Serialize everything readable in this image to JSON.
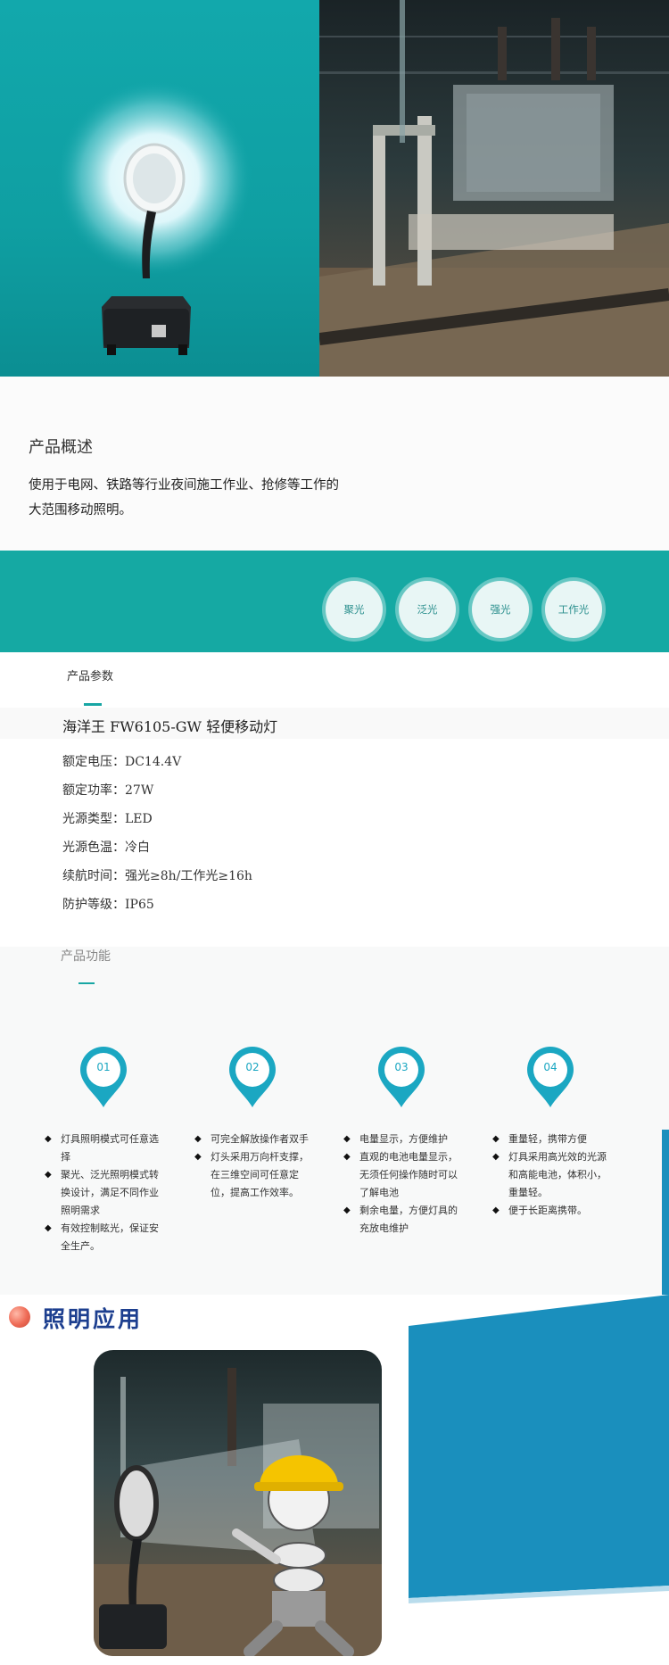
{
  "overview": {
    "title": "产品概述",
    "text_line1": "使用于电网、铁路等行业夜间施工作业、抢修等工作的",
    "text_line2": "大范围移动照明。"
  },
  "modes": [
    "聚光",
    "泛光",
    "强光",
    "工作光"
  ],
  "params": {
    "label": "产品参数",
    "title": "海洋王 FW6105-GW 轻便移动灯",
    "specs": [
      "额定电压：DC14.4V",
      "额定功率：27W",
      "光源类型：LED",
      "光源色温：冷白",
      "续航时间：强光≥8h/工作光≥16h",
      "防护等级：IP65"
    ]
  },
  "features": {
    "label": "产品功能",
    "numbers": [
      "01",
      "02",
      "03",
      "04"
    ],
    "columns": [
      [
        "灯具照明模式可任意选择",
        "聚光、泛光照明模式转换设计，满足不同作业照明需求",
        "有效控制眩光，保证安全生产。"
      ],
      [
        "可完全解放操作者双手",
        "灯头采用万向杆支撑，在三维空间可任意定位，提高工作效率。"
      ],
      [
        "电量显示，方便维护",
        "直观的电池电量显示，无须任何操作随时可以了解电池",
        "剩余电量，方便灯具的充放电维护"
      ],
      [
        "重量轻，携带方便",
        "灯具采用高光效的光源和高能电池，体积小，重量轻。",
        "便于长距离携带。"
      ]
    ]
  },
  "application": {
    "heading": "照明应用"
  },
  "colors": {
    "teal": "#15a9a3",
    "navy": "#1d3f8f",
    "blue_accent": "#1a8fbd"
  }
}
